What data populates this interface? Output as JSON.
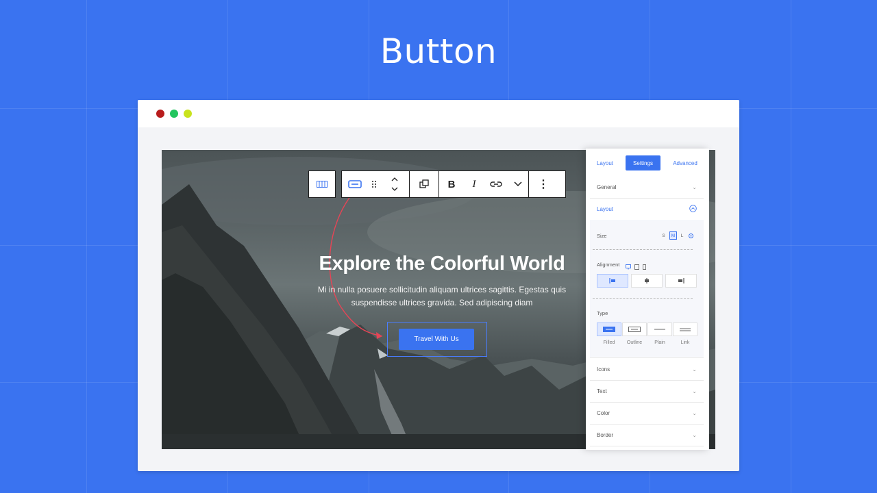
{
  "page": {
    "title": "Button"
  },
  "browser": {
    "dots": [
      "#b81c1c",
      "#22c55e",
      "#c9e31d"
    ]
  },
  "hero": {
    "title": "Explore the Colorful World",
    "subtitle_line1": "Mi in nulla posuere sollicitudin aliquam ultrices sagittis. Egestas quis",
    "subtitle_line2": "suspendisse ultrices gravida. Sed adipiscing diam",
    "button_label": "Travel With Us"
  },
  "toolbar": {
    "bold_label": "B",
    "italic_label": "I",
    "more_label": "⋮"
  },
  "panel": {
    "tabs": [
      "Layout",
      "Settings",
      "Advanced"
    ],
    "active_tab": "Settings",
    "sections": {
      "general": "General",
      "layout": "Layout",
      "icons": "Icons",
      "text": "Text",
      "color": "Color",
      "border": "Border"
    },
    "size": {
      "label": "Size",
      "options": [
        "S",
        "M",
        "L"
      ],
      "selected": "M"
    },
    "alignment": {
      "label": "Alignment",
      "options": [
        "left",
        "center",
        "right"
      ],
      "selected": "left"
    },
    "type": {
      "label": "Type",
      "options": [
        "Filled",
        "Outline",
        "Plain",
        "Link"
      ],
      "selected": "Filled"
    }
  },
  "colors": {
    "accent": "#3a73f0",
    "background": "#3a73f0",
    "arrow": "#e64556"
  }
}
